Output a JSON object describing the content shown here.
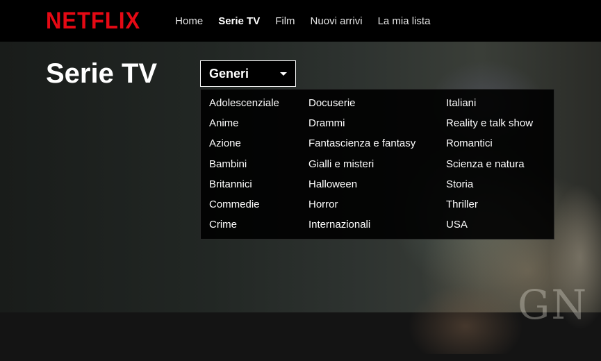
{
  "brand": {
    "logo_text": "NETFLIX",
    "logo_color": "#e50914"
  },
  "nav": {
    "items": [
      {
        "label": "Home",
        "active": false
      },
      {
        "label": "Serie TV",
        "active": true
      },
      {
        "label": "Film",
        "active": false
      },
      {
        "label": "Nuovi arrivi",
        "active": false
      },
      {
        "label": "La mia lista",
        "active": false
      }
    ]
  },
  "page": {
    "title": "Serie TV"
  },
  "genres": {
    "toggle_label": "Generi",
    "columns": [
      [
        "Adolescenziale",
        "Anime",
        "Azione",
        "Bambini",
        "Britannici",
        "Commedie",
        "Crime"
      ],
      [
        "Docuserie",
        "Drammi",
        "Fantascienza e fantasy",
        "Gialli e misteri",
        "Halloween",
        "Horror",
        "Internazionali"
      ],
      [
        "Italiani",
        "Reality e talk show",
        "Romantici",
        "Scienza e natura",
        "Storia",
        "Thriller",
        "USA"
      ]
    ]
  },
  "hero": {
    "watermark_text": "GN"
  }
}
